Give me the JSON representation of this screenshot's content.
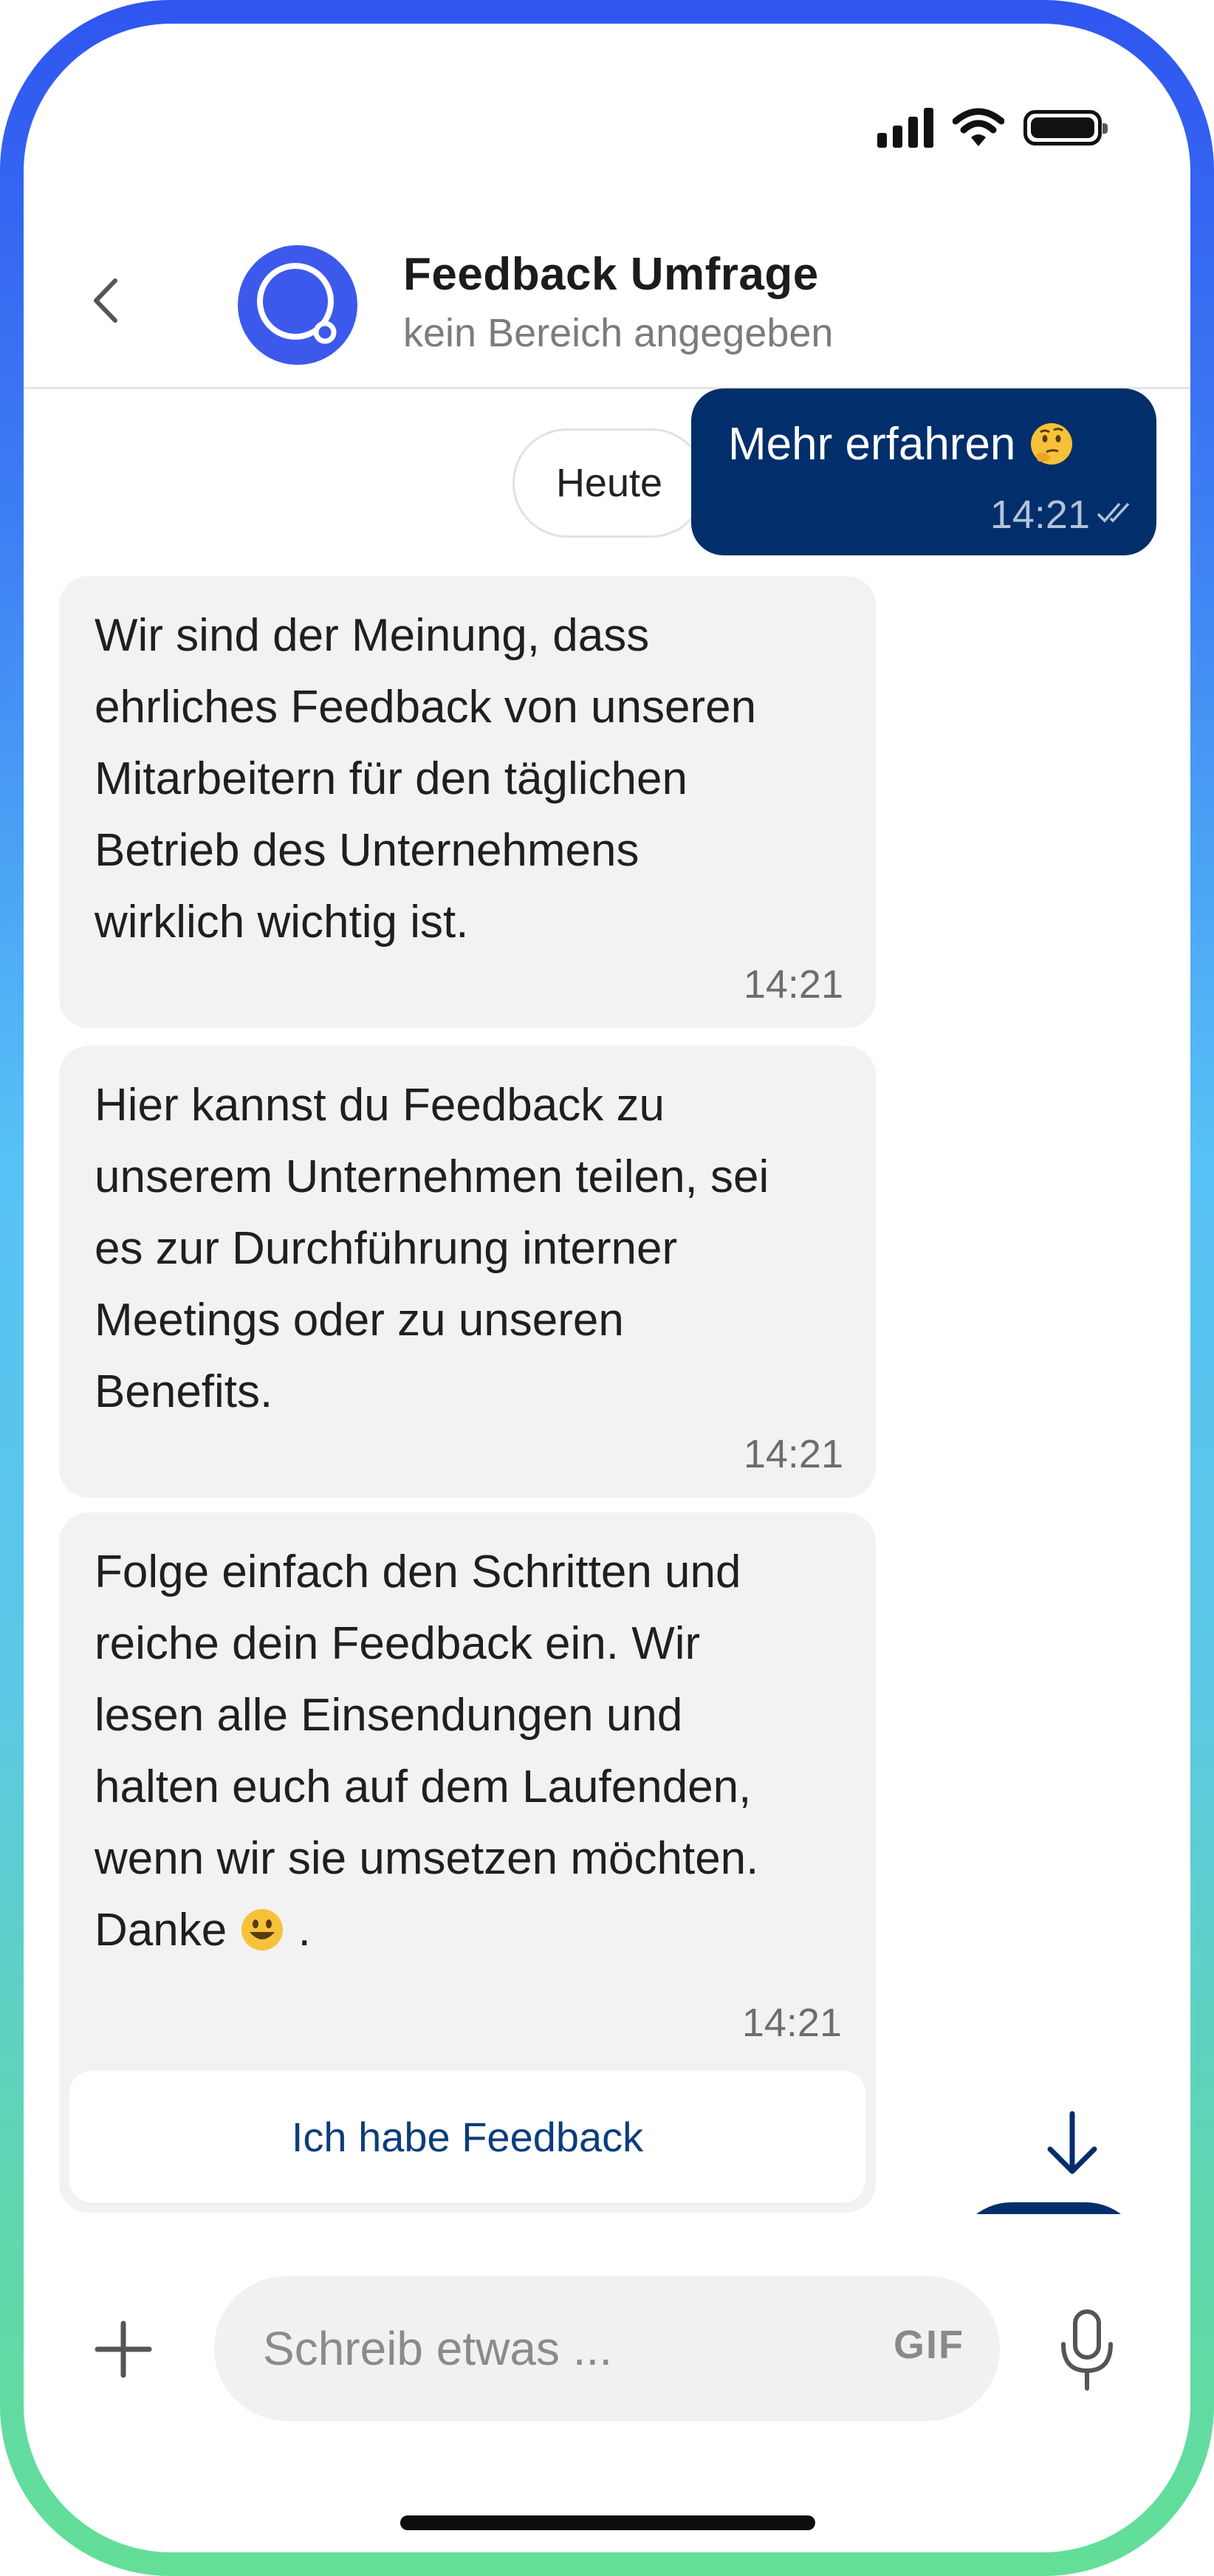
{
  "header": {
    "title": "Feedback Umfrage",
    "subtitle": "kein Bereich angegeben"
  },
  "date_chip": "Heute",
  "outgoing": {
    "text": "Mehr erfahren",
    "emoji": "thinking-face-emoji",
    "time": "14:21",
    "status": "read"
  },
  "messages": [
    {
      "lines": [
        "Wir sind der Meinung, dass",
        "ehrliches Feedback von unseren",
        "Mitarbeitern für den täglichen",
        "Betrieb des Unternehmens",
        "wirklich wichtig ist."
      ],
      "time": "14:21"
    },
    {
      "lines": [
        "Hier kannst du Feedback zu",
        "unserem Unternehmen teilen, sei",
        "es zur Durchführung interner",
        "Meetings oder zu unseren",
        "Benefits."
      ],
      "time": "14:21"
    },
    {
      "lines": [
        "Folge einfach den Schritten und",
        "reiche dein Feedback ein. Wir",
        "lesen alle Einsendungen und",
        "halten euch auf dem Laufenden,",
        "wenn wir sie umsetzen möchten."
      ],
      "last_line_text": "Danke",
      "last_line_suffix": " .",
      "last_line_emoji": "smiley-emoji",
      "time": "14:21",
      "action_label": "Ich habe Feedback"
    }
  ],
  "composer": {
    "placeholder": "Schreib etwas ...",
    "gif_label": "GIF"
  },
  "colors": {
    "accent": "#022f6b",
    "avatar": "#3c59ec",
    "bubble_in": "#f2f2f2"
  }
}
